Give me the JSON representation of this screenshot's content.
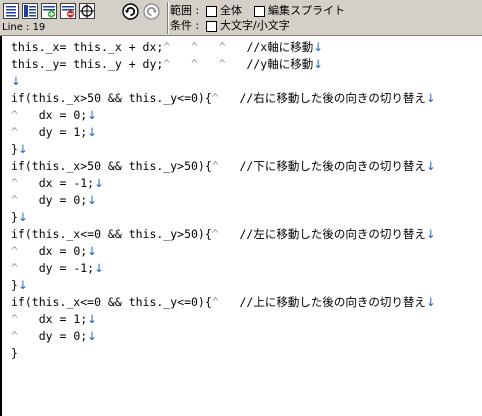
{
  "toolbar": {
    "line_label": "Line : 19",
    "range_label": "範囲 :",
    "range_opt1": "全体",
    "range_opt2": "編集スプライト",
    "cond_label": "条件 :",
    "cond_opt1": "大文字/小文字",
    "icons": [
      "list-icon",
      "list-alt-icon",
      "add-green-icon",
      "delete-red-icon",
      "target-icon",
      "undo-icon",
      "redo-icon"
    ]
  },
  "code": {
    "newline_glyph": "↓",
    "lines": [
      "this._x= this._x + dx;\t\t\t//x軸に移動",
      "this._y= this._y + dy;\t\t\t//y軸に移動",
      "",
      "if(this._x>50 && this._y<=0){\t//右に移動した後の向きの切り替え",
      "\tdx = 0;",
      "\tdy = 1;",
      "}",
      "if(this._x>50 && this._y>50){\t//下に移動した後の向きの切り替え",
      "\tdx = -1;",
      "\tdy = 0;",
      "}",
      "if(this._x<=0 && this._y>50){\t//左に移動した後の向きの切り替え",
      "\tdx = 0;",
      "\tdy = -1;",
      "}",
      "if(this._x<=0 && this._y<=0){\t//上に移動した後の向きの切り替え",
      "\tdx = 1;",
      "\tdy = 0;",
      "}"
    ]
  }
}
